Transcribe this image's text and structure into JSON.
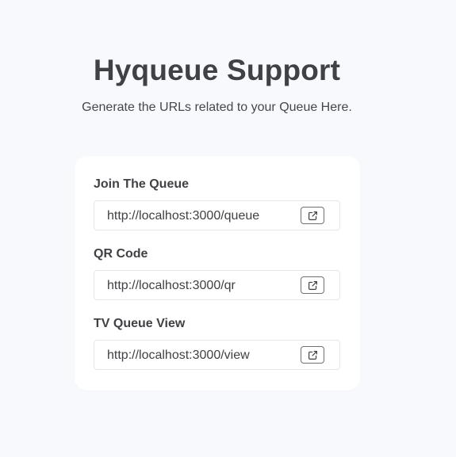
{
  "header": {
    "title": "Hyqueue Support",
    "subtitle": "Generate the URLs related to your Queue Here."
  },
  "links": [
    {
      "label": "Join The Queue",
      "url": "http://localhost:3000/queue",
      "icon": "external-link-icon"
    },
    {
      "label": "QR Code",
      "url": "http://localhost:3000/qr",
      "icon": "external-link-icon"
    },
    {
      "label": "TV Queue View",
      "url": "http://localhost:3000/view",
      "icon": "external-link-icon"
    }
  ],
  "colors": {
    "background": "#f8f9fc",
    "card": "#ffffff",
    "text": "#3f4145",
    "border": "#e6e7ea"
  }
}
